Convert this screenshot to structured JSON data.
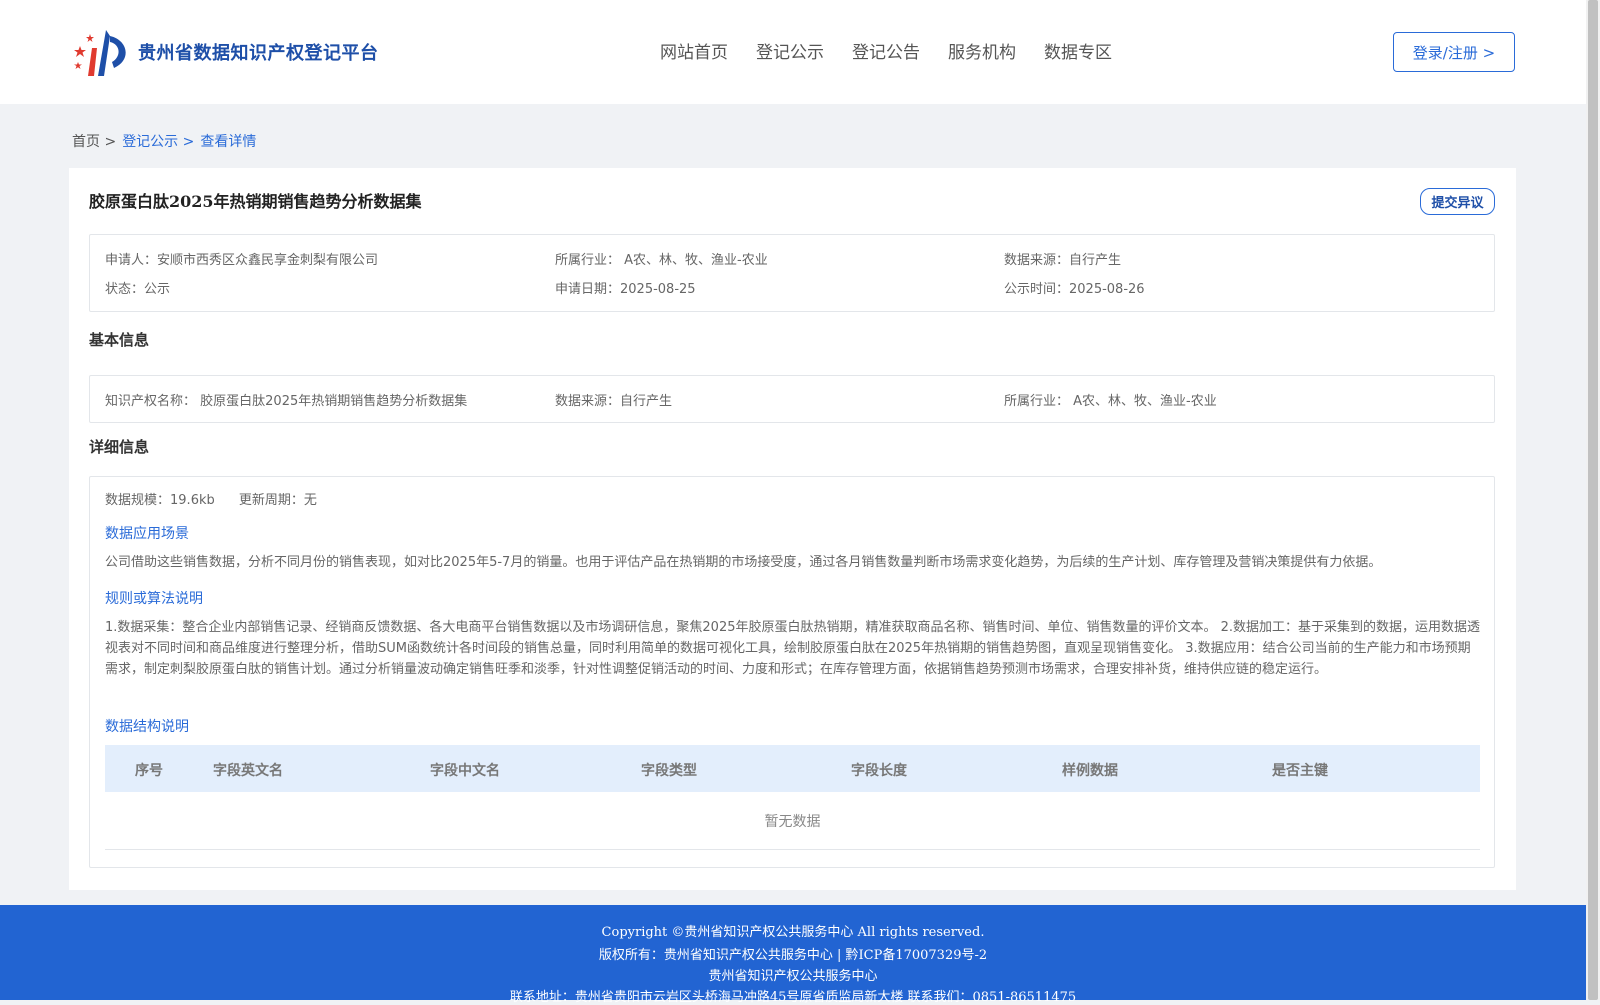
{
  "site": {
    "title": "贵州省数据知识产权登记平台"
  },
  "nav": {
    "items": [
      "网站首页",
      "登记公示",
      "登记公告",
      "服务机构",
      "数据专区"
    ]
  },
  "login_label": "登录/注册 >",
  "breadcrumb": {
    "home": "首页 >",
    "section": "登记公示 >",
    "current": "查看详情"
  },
  "detail": {
    "title": "胶原蛋白肽2025年热销期销售趋势分析数据集",
    "dispute_label": "提交异议",
    "meta": {
      "applicant_label": "申请人：",
      "applicant": "安顺市西秀区众鑫民享金刺梨有限公司",
      "industry_label": "所属行业：",
      "industry": "A农、林、牧、渔业-农业",
      "source_label": "数据来源：",
      "source": "自行产生",
      "status_label": "状态：",
      "status": "公示",
      "apply_date_label": "申请日期：",
      "apply_date": "2025-08-25",
      "publish_date_label": "公示时间：",
      "publish_date": "2025-08-26"
    },
    "basic": {
      "section_title": "基本信息",
      "ip_name_label": "知识产权名称：",
      "ip_name": "胶原蛋白肽2025年热销期销售趋势分析数据集",
      "source_label": "数据来源：",
      "source": "自行产生",
      "industry_label": "所属行业：",
      "industry": "A农、林、牧、渔业-农业"
    },
    "info": {
      "section_title": "详细信息",
      "scale_label": "数据规模：",
      "scale": "19.6kb",
      "update_label": "更新周期：",
      "update": "无",
      "scenario_title": "数据应用场景",
      "scenario_text": "公司借助这些销售数据，分析不同月份的销售表现，如对比2025年5-7月的销量。也用于评估产品在热销期的市场接受度，通过各月销售数量判断市场需求变化趋势，为后续的生产计划、库存管理及营销决策提供有力依据。",
      "rule_title": "规则或算法说明",
      "rule_text": "1.数据采集：整合企业内部销售记录、经销商反馈数据、各大电商平台销售数据以及市场调研信息，聚焦2025年胶原蛋白肽热销期，精准获取商品名称、销售时间、单位、销售数量的评价文本。 2.数据加工：基于采集到的数据，运用数据透视表对不同时间和商品维度进行整理分析，借助SUM函数统计各时间段的销售总量，同时利用简单的数据可视化工具，绘制胶原蛋白肽在2025年热销期的销售趋势图，直观呈现销售变化。 3.数据应用：结合公司当前的生产能力和市场预期需求，制定刺梨胶原蛋白肽的销售计划。通过分析销量波动确定销售旺季和淡季，针对性调整促销活动的时间、力度和形式；在库存管理方面，依据销售趋势预测市场需求，合理安排补货，维持供应链的稳定运行。",
      "structure_title": "数据结构说明",
      "columns": [
        "序号",
        "字段英文名",
        "字段中文名",
        "字段类型",
        "字段长度",
        "样例数据",
        "是否主键"
      ],
      "empty_text": "暂无数据"
    }
  },
  "footer": {
    "copyright": "Copyright ©贵州省知识产权公共服务中心 All rights reserved.",
    "owner": "版权所有：贵州省知识产权公共服务中心 | 黔ICP备17007329号-2",
    "org": "贵州省知识产权公共服务中心",
    "contact": "联系地址：贵州省贵阳市云岩区头桥海马冲路45号原省质监局新大楼 联系我们：0851-86511475"
  },
  "colors": {
    "accent": "#2a6bd8",
    "footer_bg": "#2264d2",
    "logo_red": "#e03a2f"
  }
}
